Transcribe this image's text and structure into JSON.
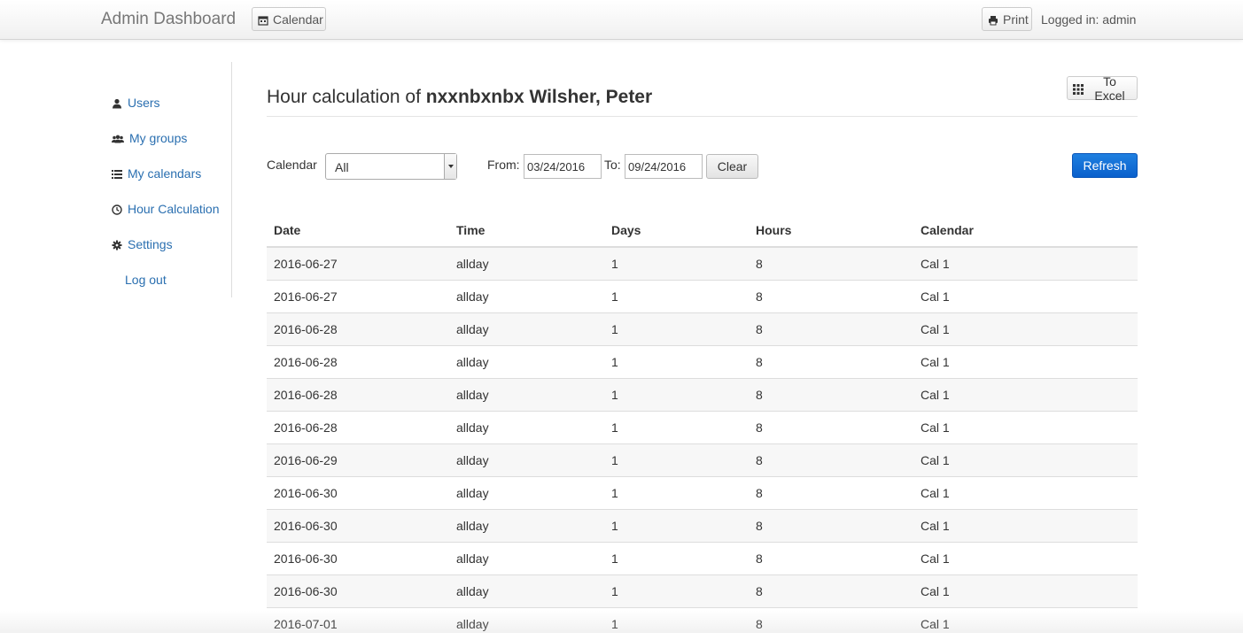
{
  "navbar": {
    "brand": "Admin Dashboard",
    "calendar_label": "Calendar",
    "print_label": "Print",
    "logged_in": "Logged in: admin"
  },
  "sidebar": {
    "items": [
      {
        "label": "Users",
        "icon": "user-icon"
      },
      {
        "label": "My groups",
        "icon": "group-icon"
      },
      {
        "label": "My calendars",
        "icon": "list-icon"
      },
      {
        "label": "Hour Calculation",
        "icon": "clock-icon"
      },
      {
        "label": "Settings",
        "icon": "gear-icon"
      },
      {
        "label": "Log out",
        "icon": ""
      }
    ]
  },
  "main": {
    "title_prefix": "Hour calculation of ",
    "title_name": "nxxnbxnbx Wilsher, Peter",
    "excel_label": "To Excel",
    "filters": {
      "calendar_label": "Calendar",
      "calendar_value": "All",
      "from_label": "From:",
      "from_value": "03/24/2016",
      "to_label": "To:",
      "to_value": "09/24/2016",
      "clear_label": "Clear",
      "refresh_label": "Refresh"
    },
    "table": {
      "headers": [
        "Date",
        "Time",
        "Days",
        "Hours",
        "Calendar"
      ],
      "rows": [
        [
          "2016-06-27",
          "allday",
          "1",
          "8",
          "Cal 1"
        ],
        [
          "2016-06-27",
          "allday",
          "1",
          "8",
          "Cal 1"
        ],
        [
          "2016-06-28",
          "allday",
          "1",
          "8",
          "Cal 1"
        ],
        [
          "2016-06-28",
          "allday",
          "1",
          "8",
          "Cal 1"
        ],
        [
          "2016-06-28",
          "allday",
          "1",
          "8",
          "Cal 1"
        ],
        [
          "2016-06-28",
          "allday",
          "1",
          "8",
          "Cal 1"
        ],
        [
          "2016-06-29",
          "allday",
          "1",
          "8",
          "Cal 1"
        ],
        [
          "2016-06-30",
          "allday",
          "1",
          "8",
          "Cal 1"
        ],
        [
          "2016-06-30",
          "allday",
          "1",
          "8",
          "Cal 1"
        ],
        [
          "2016-06-30",
          "allday",
          "1",
          "8",
          "Cal 1"
        ],
        [
          "2016-06-30",
          "allday",
          "1",
          "8",
          "Cal 1"
        ],
        [
          "2016-07-01",
          "allday",
          "1",
          "8",
          "Cal 1"
        ]
      ]
    }
  },
  "colors": {
    "link": "#2a6fb0",
    "primary_button": "#0a60cc"
  }
}
